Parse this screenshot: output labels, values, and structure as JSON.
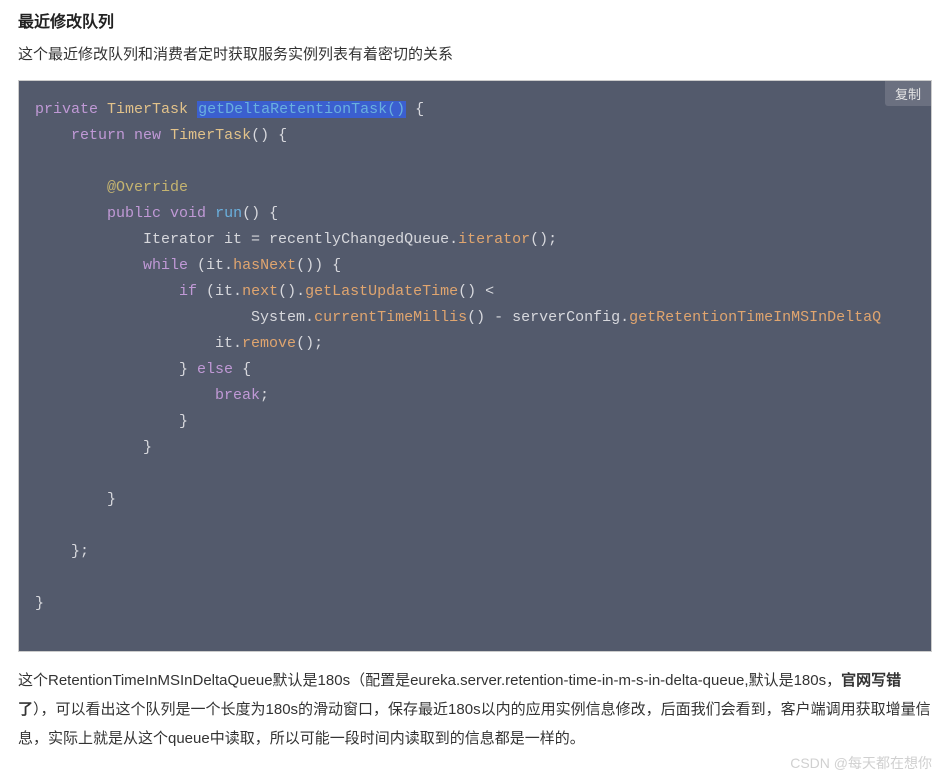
{
  "article": {
    "section_title": "最近修改队列",
    "intro": "这个最近修改队列和消费者定时获取服务实例列表有着密切的关系",
    "para_before_bold": "这个RetentionTimeInMSInDeltaQueue默认是180s（配置是eureka.server.retention-time-in-m-s-in-delta-queue,默认是180s，",
    "para_bold": "官网写错了",
    "para_after_bold": "），可以看出这个队列是一个长度为180s的滑动窗口，保存最近180s以内的应用实例信息修改，后面我们会看到，客户端调用获取增量信息，实际上就是从这个queue中读取，所以可能一段时间内读取到的信息都是一样的。"
  },
  "codeblock": {
    "copy_label": "复制",
    "tokens": {
      "kw_private": "private",
      "type_TimerTask": "TimerTask",
      "method_hl": "getDeltaRetentionTask()",
      "brace_open": " {",
      "indent1": "    ",
      "kw_return": "return",
      "kw_new": "new",
      "after_new": "() {",
      "blank": "",
      "ann_override": "@Override",
      "kw_public": "public",
      "kw_void": "void",
      "method_run": "run",
      "after_run": "() {",
      "line_iter": "Iterator it = recentlyChangedQueue.",
      "call_iterator": "iterator",
      "after_iterator": "();",
      "kw_while": "while",
      "after_while": " (it.",
      "call_hasNext": "hasNext",
      "after_hasNext": "()) {",
      "kw_if": "if",
      "after_if": " (it.",
      "call_next": "next",
      "after_next": "().",
      "call_getLast": "getLastUpdateTime",
      "after_getLast": "() <",
      "sys_prefix": "System.",
      "call_ctm": "currentTimeMillis",
      "after_ctm": "() - serverConfig.",
      "call_getRet": "getRetentionTimeInMSInDeltaQ",
      "line_remove_prefix": "it.",
      "call_remove": "remove",
      "after_remove": "();",
      "close_if": "} ",
      "kw_else": "else",
      "after_else": " {",
      "kw_break": "break",
      "semi": ";",
      "brace_close": "}",
      "end_inner": "};",
      "space": " "
    }
  },
  "watermark": "CSDN @每天都在想你"
}
